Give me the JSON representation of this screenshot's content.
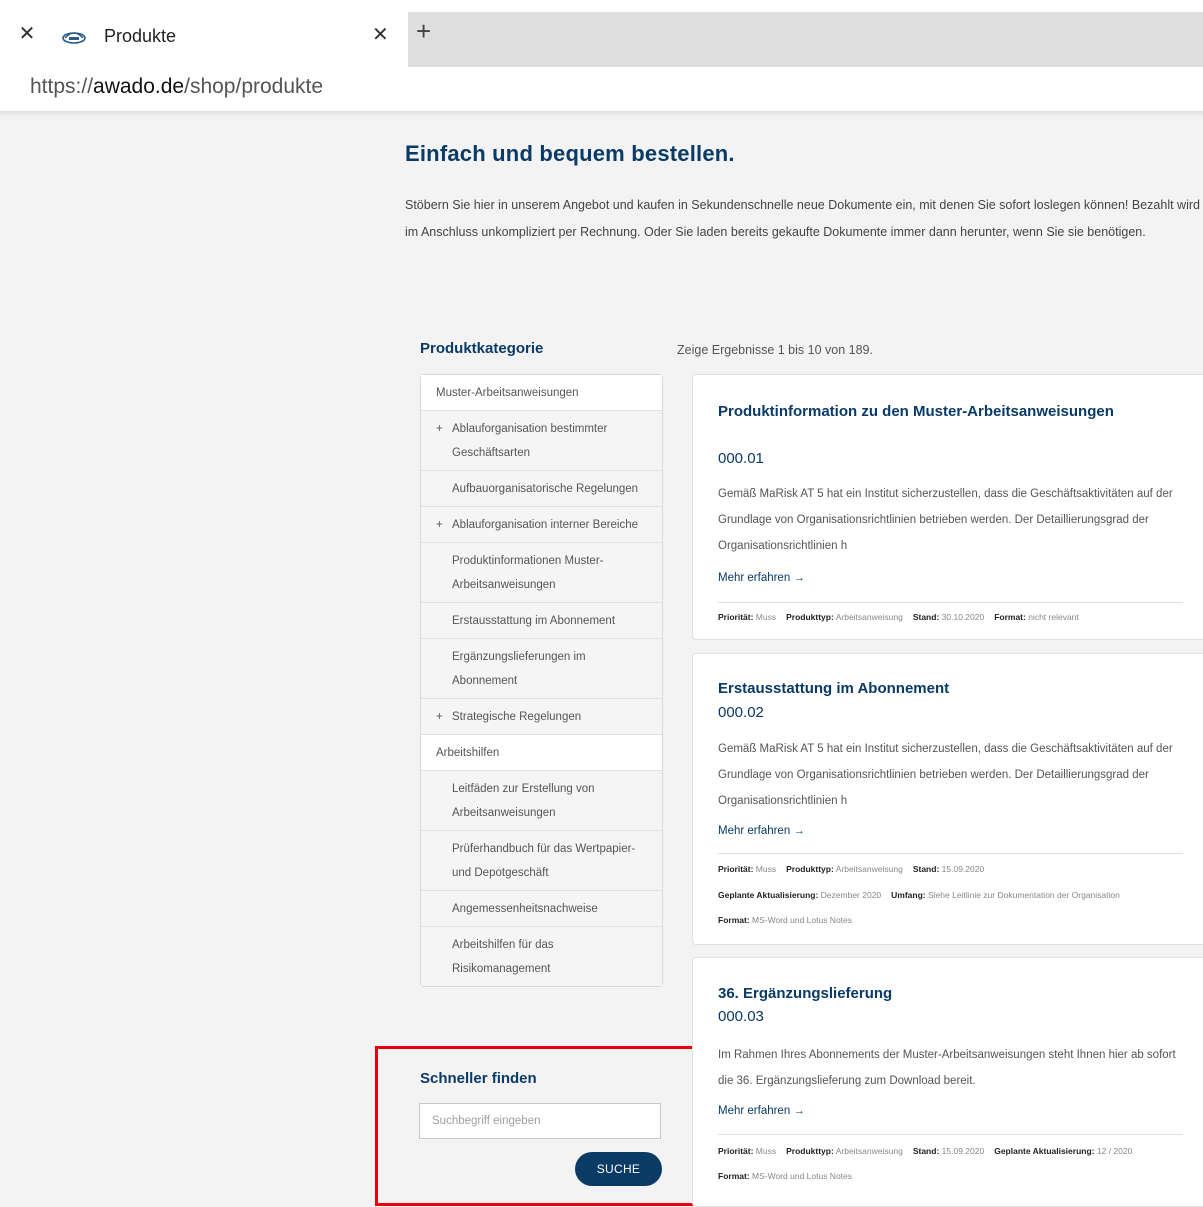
{
  "browser": {
    "tab_title": "Produkte",
    "url_prefix": "https://",
    "url_domain": "awado.de",
    "url_path": "/shop/produkte"
  },
  "page": {
    "headline": "Einfach und bequem bestellen.",
    "intro": "Stöbern Sie hier in unserem Angebot und kaufen in Sekundenschnelle neue Dokumente ein, mit denen Sie sofort loslegen können! Bezahlt wird im Anschluss unkompliziert per Rechnung. Oder Sie laden bereits gekaufte Dokumente immer dann herunter, wenn Sie sie benötigen.",
    "results_count": "Zeige Ergebnisse 1 bis 10 von 189."
  },
  "sidebar": {
    "heading": "Produktkategorie",
    "items": [
      {
        "label": "Muster-Arbeitsanweisungen",
        "level": "top",
        "plus": ""
      },
      {
        "label": "Ablauforganisation bestimmter Geschäftsarten",
        "level": "sub",
        "plus": "+"
      },
      {
        "label": "Aufbauorganisatorische Regelungen",
        "level": "sub",
        "plus": ""
      },
      {
        "label": "Ablauforganisation interner Bereiche",
        "level": "sub",
        "plus": "+"
      },
      {
        "label": "Produktinformationen Muster-Arbeitsanweisungen",
        "level": "sub",
        "plus": ""
      },
      {
        "label": "Erstausstattung im Abonnement",
        "level": "sub",
        "plus": ""
      },
      {
        "label": "Ergänzungslieferungen im Abonnement",
        "level": "sub",
        "plus": ""
      },
      {
        "label": "Strategische Regelungen",
        "level": "sub",
        "plus": "+"
      },
      {
        "label": "Arbeitshilfen",
        "level": "top",
        "plus": ""
      },
      {
        "label": "Leitfäden zur Erstellung von Arbeitsanweisungen",
        "level": "sub",
        "plus": ""
      },
      {
        "label": "Prüferhandbuch für das Wertpapier- und Depotgeschäft",
        "level": "sub",
        "plus": ""
      },
      {
        "label": "Angemessenheitsnachweise",
        "level": "sub",
        "plus": ""
      },
      {
        "label": "Arbeitshilfen für das Risikomanagement",
        "level": "sub",
        "plus": ""
      }
    ]
  },
  "search": {
    "heading": "Schneller finden",
    "placeholder": "Suchbegriff eingeben",
    "button_label": "SUCHE"
  },
  "products": [
    {
      "title": "Produktinformation zu den Muster-Arbeitsanweisungen",
      "number": "000.01",
      "description": "Gemäß MaRisk AT 5 hat ein Institut sicherzustellen, dass die Geschäftsaktivitäten auf der Grundlage von Organisationsrichtlinien betrieben werden. Der Detaillierungsgrad der Organisationsrichtlinien h",
      "more": "Mehr erfahren →",
      "meta_line1": [
        {
          "k": "Priorität:",
          "v": "Muss"
        },
        {
          "k": "Produkttyp:",
          "v": "Arbeitsanweisung"
        },
        {
          "k": "Stand:",
          "v": "30.10.2020"
        },
        {
          "k": "Format:",
          "v": "nicht relevant"
        }
      ]
    },
    {
      "title": "Erstausstattung im Abonnement",
      "number": "000.02",
      "description": "Gemäß MaRisk AT 5 hat ein Institut sicherzustellen, dass die Geschäftsaktivitäten auf der Grundlage von Organisationsrichtlinien betrieben werden. Der Detaillierungsgrad der Organisationsrichtlinien h",
      "more": "Mehr erfahren →",
      "meta_line1": [
        {
          "k": "Priorität:",
          "v": "Muss"
        },
        {
          "k": "Produkttyp:",
          "v": "Arbeitsanweisung"
        },
        {
          "k": "Stand:",
          "v": "15.09.2020"
        }
      ],
      "meta_line2": [
        {
          "k": "Geplante Aktualisierung:",
          "v": "Dezember 2020"
        },
        {
          "k": "Umfang:",
          "v": "Siehe Leitlinie zur Dokumentation der Organisation"
        }
      ],
      "meta_line3": [
        {
          "k": "Format:",
          "v": "MS-Word und Lotus Notes"
        }
      ]
    },
    {
      "title": "36. Ergänzungslieferung",
      "number": "000.03",
      "description": "Im Rahmen Ihres Abonnements der Muster-Arbeitsanweisungen steht Ihnen hier ab sofort die 36. Ergänzungslieferung zum Download bereit.",
      "more": "Mehr erfahren →",
      "meta_line1": [
        {
          "k": "Priorität:",
          "v": "Muss"
        },
        {
          "k": "Produkttyp:",
          "v": "Arbeitsanweisung"
        },
        {
          "k": "Stand:",
          "v": "15.09.2020"
        },
        {
          "k": "Geplante Aktualisierung:",
          "v": "12 / 2020"
        }
      ],
      "meta_line2": [
        {
          "k": "Format:",
          "v": "MS-Word und Lotus Notes"
        }
      ]
    }
  ],
  "colors": {
    "brand_navy": "#0a3a66",
    "highlight_red": "#e8000b",
    "page_bg": "#f3f3f3"
  }
}
